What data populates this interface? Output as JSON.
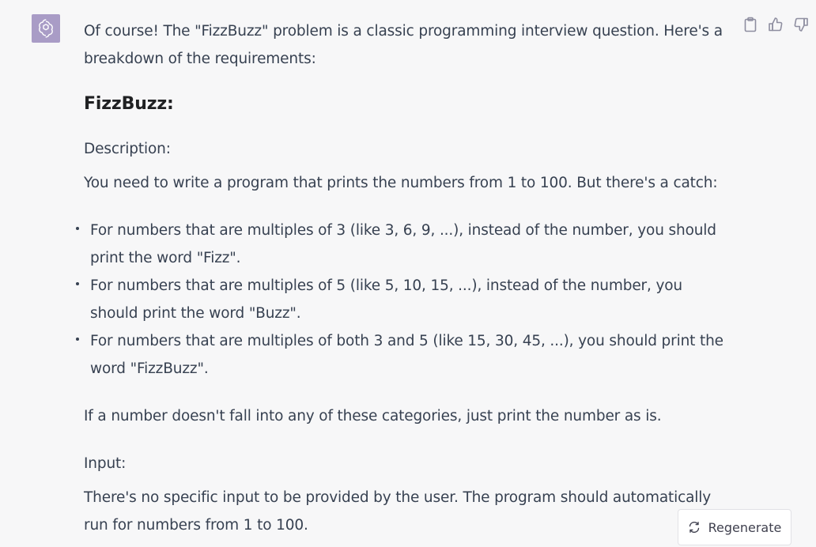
{
  "message": {
    "avatar_icon": "openai-logo-icon",
    "intro": "Of course! The \"FizzBuzz\" problem is a classic programming interview question. Here's a breakdown of the requirements:",
    "heading": "FizzBuzz:",
    "description_label": "Description:",
    "description_text": "You need to write a program that prints the numbers from 1 to 100. But there's a catch:",
    "bullets": [
      "For numbers that are multiples of 3 (like 3, 6, 9, ...), instead of the number, you should print the word \"Fizz\".",
      "For numbers that are multiples of 5 (like 5, 10, 15, ...), instead of the number, you should print the word \"Buzz\".",
      "For numbers that are multiples of both 3 and 5 (like 15, 30, 45, ...), you should print the word \"FizzBuzz\"."
    ],
    "after_list": "If a number doesn't fall into any of these categories, just print the number as is.",
    "input_label": "Input:",
    "input_text": "There's no specific input to be provided by the user. The program should automatically run for numbers from 1 to 100."
  },
  "actions": {
    "copy_icon": "clipboard-icon",
    "thumbs_up_icon": "thumbs-up-icon",
    "thumbs_down_icon": "thumbs-down-icon"
  },
  "regenerate": {
    "label": "Regenerate",
    "icon": "refresh-icon"
  },
  "colors": {
    "background": "#f7f7f8",
    "avatar": "#a99cc6",
    "text": "#374151"
  }
}
